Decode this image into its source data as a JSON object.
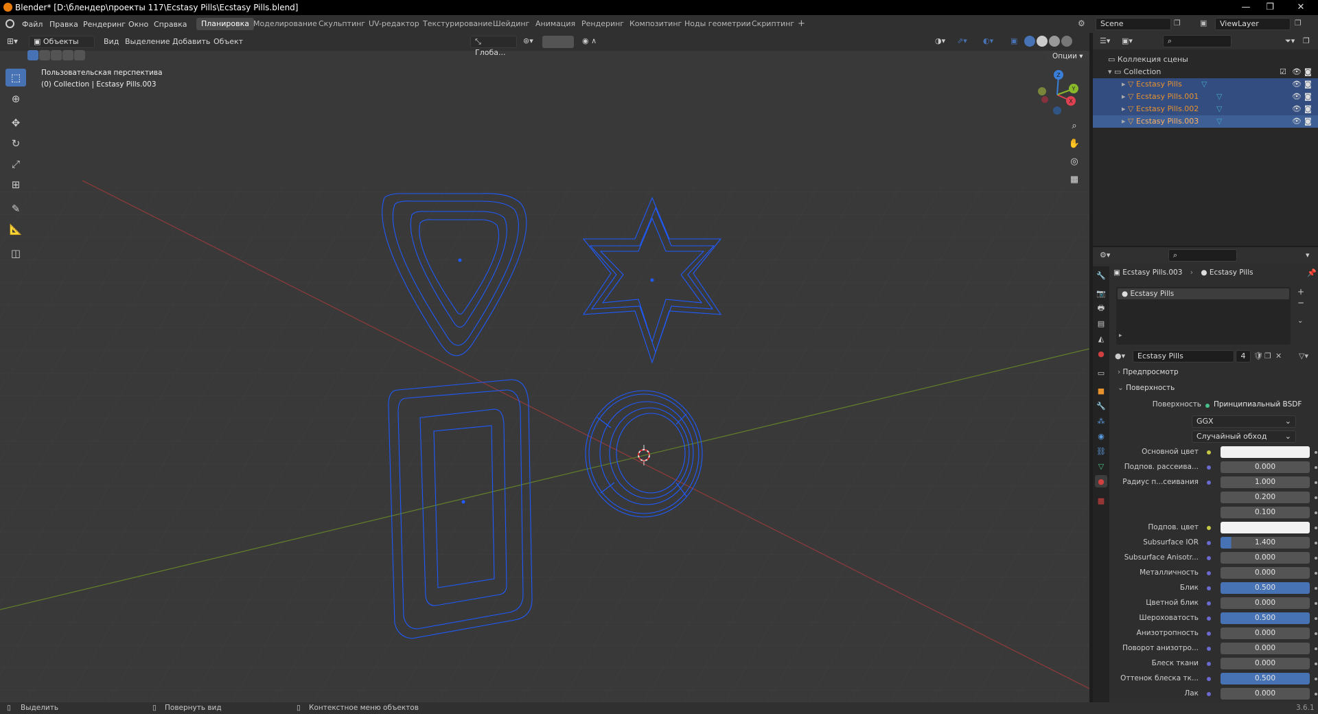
{
  "title_bar": {
    "title": "Blender* [D:\\блендер\\проекты 117\\Ecstasy Pills\\Ecstasy Pills.blend]",
    "controls": [
      "—",
      "❐",
      "✕"
    ]
  },
  "menu": {
    "items": [
      "Файл",
      "Правка",
      "Рендеринг",
      "Окно",
      "Справка"
    ]
  },
  "workspaces": {
    "tabs": [
      "Планировка",
      "Моделирование",
      "Скульптинг",
      "UV-редактор",
      "Текстурирование",
      "Шейдинг",
      "Анимация",
      "Рендеринг",
      "Композитинг",
      "Ноды геометрии",
      "Скриптинг"
    ],
    "active": "Планировка",
    "add": "+"
  },
  "scene": {
    "label": "Scene"
  },
  "view_layer": {
    "label": "ViewLayer"
  },
  "viewport": {
    "mode": "Объекты",
    "menus": [
      "Вид",
      "Выделение",
      "Добавить",
      "Объект"
    ],
    "orientation": "Глоба...",
    "options_label": "Опции",
    "overlay_line1": "Пользовательская перспектива",
    "overlay_line2": "(0) Collection | Ecstasy Pills.003",
    "gizmo_axes": {
      "x": "X",
      "y": "Y",
      "z": "Z"
    }
  },
  "outliner": {
    "scene_collection": "Коллекция сцены",
    "collection": "Collection",
    "objects": [
      {
        "name": "Ecstasy Pills",
        "selected": true
      },
      {
        "name": "Ecstasy Pills.001",
        "selected": true
      },
      {
        "name": "Ecstasy Pills.002",
        "selected": true
      },
      {
        "name": "Ecstasy Pills.003",
        "selected": true,
        "active": true
      }
    ]
  },
  "properties": {
    "breadcrumb_object": "Ecstasy Pills.003",
    "breadcrumb_material": "Ecstasy Pills",
    "slot_material": "Ecstasy Pills",
    "material_name": "Ecstasy Pills",
    "user_count": "4",
    "panel_preview": "Предпросмотр",
    "panel_surface": "Поверхность",
    "surface_label": "Поверхность",
    "surface_value": "Принципиальный BSDF",
    "distribution": "GGX",
    "subsurface_method": "Случайный обход",
    "rows": [
      {
        "label": "Основной цвет",
        "value": "",
        "style": "white"
      },
      {
        "label": "Подпов. рассеива...",
        "value": "0.000",
        "style": "normal"
      },
      {
        "label": "Радиус п...сеивания",
        "value": "1.000",
        "style": "normal"
      },
      {
        "label": "",
        "value": "0.200",
        "style": "normal"
      },
      {
        "label": "",
        "value": "0.100",
        "style": "normal"
      },
      {
        "label": "Подпов. цвет",
        "value": "",
        "style": "white"
      },
      {
        "label": "Subsurface IOR",
        "value": "1.400",
        "style": "partial"
      },
      {
        "label": "Subsurface Anisotr...",
        "value": "0.000",
        "style": "normal"
      },
      {
        "label": "Металличность",
        "value": "0.000",
        "style": "normal"
      },
      {
        "label": "Блик",
        "value": "0.500",
        "style": "hl"
      },
      {
        "label": "Цветной блик",
        "value": "0.000",
        "style": "normal"
      },
      {
        "label": "Шероховатость",
        "value": "0.500",
        "style": "hl"
      },
      {
        "label": "Анизотропность",
        "value": "0.000",
        "style": "normal"
      },
      {
        "label": "Поворот анизотро...",
        "value": "0.000",
        "style": "normal"
      },
      {
        "label": "Блеск ткани",
        "value": "0.000",
        "style": "normal"
      },
      {
        "label": "Оттенок блеска тк...",
        "value": "0.500",
        "style": "hl"
      },
      {
        "label": "Лак",
        "value": "0.000",
        "style": "normal"
      }
    ]
  },
  "status_bar": {
    "select": "Выделить",
    "rotate": "Повернуть вид",
    "context": "Контекстное меню объектов",
    "version": "3.6.1"
  },
  "colors": {
    "accent": "#4772b3",
    "selection": "#334d80",
    "wire": "#1f5bff",
    "object_orange": "#e8922e"
  }
}
